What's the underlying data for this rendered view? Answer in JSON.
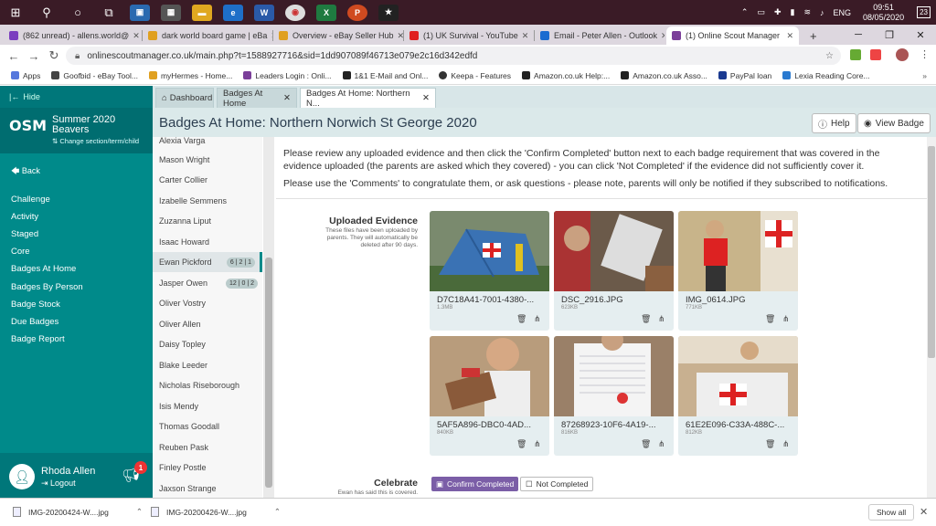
{
  "taskbar": {
    "lang": "ENG",
    "time": "09:51",
    "date": "08/05/2020",
    "notif_count": "23"
  },
  "browser": {
    "tabs": [
      {
        "label": "(862 unread) - allens.world@",
        "color": "#7b3fbf"
      },
      {
        "label": "dark world board game | eBa",
        "color": "#e0a020"
      },
      {
        "label": "Overview - eBay Seller Hub",
        "color": "#e0a020"
      },
      {
        "label": "(1) UK Survival - YouTube",
        "color": "#e02020"
      },
      {
        "label": "Email - Peter Allen - Outlook",
        "color": "#1a6bd0"
      },
      {
        "label": "(1) Online Scout Manager",
        "color": "#7b3f9a"
      }
    ],
    "new_tab": "+",
    "url": "onlinescoutmanager.co.uk/main.php?t=1588927716&sid=1dd907089f46713e079e2c16d342edfd",
    "bookmarks": [
      {
        "label": "Apps",
        "color": "#5577dd"
      },
      {
        "label": "Goofbid - eBay Tool...",
        "color": "#444"
      },
      {
        "label": "myHermes - Home...",
        "color": "#e0a020"
      },
      {
        "label": "Leaders Login : Onli...",
        "color": "#7b3f9a"
      },
      {
        "label": "1&1 E-Mail and Onl...",
        "color": "#222"
      },
      {
        "label": "Keepa - Features",
        "color": "#333"
      },
      {
        "label": "Amazon.co.uk Help:...",
        "color": "#222"
      },
      {
        "label": "Amazon.co.uk Asso...",
        "color": "#222"
      },
      {
        "label": "PayPal loan",
        "color": "#1a3a90"
      },
      {
        "label": "Lexia Reading Core...",
        "color": "#2a7ad0"
      }
    ]
  },
  "sidebar": {
    "hide": "Hide",
    "logo": "OSM",
    "term": "Summer 2020",
    "section": "Beavers",
    "change": "Change section/term/child",
    "back": "Back",
    "items": [
      "Challenge",
      "Activity",
      "Staged",
      "Core",
      "Badges At Home",
      "Badges By Person",
      "Badge Stock",
      "Due Badges",
      "Badge Report"
    ],
    "user": "Rhoda Allen",
    "logout": "Logout",
    "notif": "1"
  },
  "app_tabs": [
    "Dashboard",
    "Badges At Home",
    "Badges At Home: Northern N..."
  ],
  "page_title": "Badges At Home: Northern Norwich St George 2020",
  "help_btn": "Help",
  "view_badge_btn": "View Badge",
  "names": [
    {
      "name": "Alexia Varga",
      "badge": ""
    },
    {
      "name": "Mason Wright",
      "badge": ""
    },
    {
      "name": "Carter Collier",
      "badge": ""
    },
    {
      "name": "Izabelle Semmens",
      "badge": ""
    },
    {
      "name": "Zuzanna Liput",
      "badge": ""
    },
    {
      "name": "Isaac Howard",
      "badge": ""
    },
    {
      "name": "Ewan Pickford",
      "badge": "6 | 2 | 1"
    },
    {
      "name": "Jasper Owen",
      "badge": "12 | 0 | 2"
    },
    {
      "name": "Oliver Vostry",
      "badge": ""
    },
    {
      "name": "Oliver Allen",
      "badge": ""
    },
    {
      "name": "Daisy Topley",
      "badge": ""
    },
    {
      "name": "Blake Leeder",
      "badge": ""
    },
    {
      "name": "Nicholas Riseborough",
      "badge": ""
    },
    {
      "name": "Isis Mendy",
      "badge": ""
    },
    {
      "name": "Thomas Goodall",
      "badge": ""
    },
    {
      "name": "Reuben Pask",
      "badge": ""
    },
    {
      "name": "Finley Postle",
      "badge": ""
    },
    {
      "name": "Jaxson Strange",
      "badge": ""
    }
  ],
  "instructions": {
    "line1": "Please review any uploaded evidence and then click the 'Confirm Completed' button next to each badge requirement that was covered in the evidence uploaded (the parents are asked which they covered) - you can click 'Not Completed' if the evidence did not sufficiently cover it.",
    "line2": "Please use the 'Comments' to congratulate them, or ask questions - please note, parents will only be notified if they subscribed to notifications."
  },
  "evidence": {
    "label": "Uploaded Evidence",
    "note": "These files have been uploaded by parents. They will automatically be deleted after 90 days.",
    "files": [
      {
        "name": "D7C18A41-7001-4380-...",
        "size": "1.3MB"
      },
      {
        "name": "DSC_2916.JPG",
        "size": "623KB"
      },
      {
        "name": "IMG_0614.JPG",
        "size": "771KB"
      },
      {
        "name": "5AF5A896-DBC0-4AD...",
        "size": "840KB"
      },
      {
        "name": "87268923-10F6-4A19-...",
        "size": "816KB"
      },
      {
        "name": "61E2E096-C33A-488C-...",
        "size": "812KB"
      }
    ]
  },
  "celebrate": {
    "label": "Celebrate",
    "note": "Ewan has said this is covered.",
    "confirm": "Confirm Completed",
    "not_completed": "Not Completed"
  },
  "downloads": {
    "items": [
      "IMG-20200424-W....jpg",
      "IMG-20200426-W....jpg"
    ],
    "show_all": "Show all"
  }
}
